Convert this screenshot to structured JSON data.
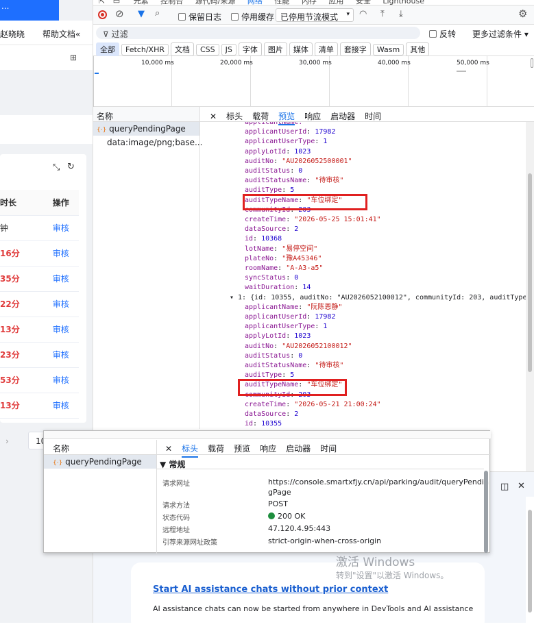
{
  "left": {
    "topbar_text": "...",
    "user_name": "赵晓晓",
    "help_doc": "帮助文档",
    "help_chevron": "«",
    "table": {
      "headers": [
        "时长",
        "操作"
      ],
      "rows": [
        {
          "duration": "钟",
          "action": "审核"
        },
        {
          "duration": "16分",
          "action": "审核"
        },
        {
          "duration": "35分",
          "action": "审核"
        },
        {
          "duration": "22分",
          "action": "审核"
        },
        {
          "duration": "13分",
          "action": "审核"
        },
        {
          "duration": "23分",
          "action": "审核"
        },
        {
          "duration": "53分",
          "action": "审核"
        },
        {
          "duration": "13分",
          "action": "审核"
        }
      ]
    },
    "pager_page": "10"
  },
  "devtools": {
    "top_tabs": [
      "元素",
      "控制台",
      "源代码/来源",
      "网络",
      "性能",
      "内存",
      "应用",
      "安全",
      "Lighthouse"
    ],
    "toolbar": {
      "preserve_log": "保留日志",
      "disable_cache": "停用缓存",
      "throttle": "已停用节流模式"
    },
    "filter": {
      "placeholder": "过滤",
      "invert": "反转",
      "more_filters": "更多过滤条件"
    },
    "filter_types": [
      "全部",
      "Fetch/XHR",
      "文档",
      "CSS",
      "JS",
      "字体",
      "图片",
      "媒体",
      "清单",
      "套接字",
      "Wasm",
      "其他"
    ],
    "timeline_ticks": [
      "10,000 ms",
      "20,000 ms",
      "30,000 ms",
      "40,000 ms",
      "50,000 ms"
    ],
    "list_header": "名称",
    "requests": [
      "queryPendingPage",
      "data:image/png;base..."
    ],
    "detail_tabs": [
      "标头",
      "载荷",
      "预览",
      "响应",
      "启动器",
      "时间"
    ],
    "preview": {
      "top_cut": "applicantName: \"\"",
      "item0": [
        {
          "k": "applicantUserId",
          "v": "17982",
          "t": "n"
        },
        {
          "k": "applicantUserType",
          "v": "1",
          "t": "n"
        },
        {
          "k": "applyLotId",
          "v": "1023",
          "t": "n"
        },
        {
          "k": "auditNo",
          "v": "\"AU2026052500001\"",
          "t": "s"
        },
        {
          "k": "auditStatus",
          "v": "0",
          "t": "n"
        },
        {
          "k": "auditStatusName",
          "v": "\"待审核\"",
          "t": "s"
        },
        {
          "k": "auditType",
          "v": "5",
          "t": "n"
        },
        {
          "k": "auditTypeName",
          "v": "\"车位绑定\"",
          "t": "s"
        },
        {
          "k": "communityId",
          "v": "203",
          "t": "n"
        },
        {
          "k": "createTime",
          "v": "\"2026-05-25 15:01:41\"",
          "t": "s"
        },
        {
          "k": "dataSource",
          "v": "2",
          "t": "n"
        },
        {
          "k": "id",
          "v": "10368",
          "t": "n"
        },
        {
          "k": "lotName",
          "v": "\"易停空间\"",
          "t": "s"
        },
        {
          "k": "plateNo",
          "v": "\"豫A45346\"",
          "t": "s"
        },
        {
          "k": "roomName",
          "v": "\"A-A3-a5\"",
          "t": "s"
        },
        {
          "k": "syncStatus",
          "v": "0",
          "t": "n"
        },
        {
          "k": "waitDuration",
          "v": "14",
          "t": "n"
        }
      ],
      "item1_header": "▾ 1: {id: 10355, auditNo: \"AU2026052100012\", communityId: 203, auditType: 5, auc",
      "item1": [
        {
          "k": "applicantName",
          "v": "\"阮陈恩静\"",
          "t": "s"
        },
        {
          "k": "applicantUserId",
          "v": "17982",
          "t": "n"
        },
        {
          "k": "applicantUserType",
          "v": "1",
          "t": "n"
        },
        {
          "k": "applyLotId",
          "v": "1023",
          "t": "n"
        },
        {
          "k": "auditNo",
          "v": "\"AU2026052100012\"",
          "t": "s"
        },
        {
          "k": "auditStatus",
          "v": "0",
          "t": "n"
        },
        {
          "k": "auditStatusName",
          "v": "\"待审核\"",
          "t": "s"
        },
        {
          "k": "auditType",
          "v": "5",
          "t": "n"
        },
        {
          "k": "auditTypeName",
          "v": "\"车位绑定\"",
          "t": "s"
        },
        {
          "k": "communityId",
          "v": "203",
          "t": "n"
        },
        {
          "k": "createTime",
          "v": "\"2026-05-21 21:00:24\"",
          "t": "s"
        },
        {
          "k": "dataSource",
          "v": "2",
          "t": "n"
        },
        {
          "k": "id",
          "v": "10355",
          "t": "n"
        }
      ]
    },
    "overlay": {
      "list_header": "名称",
      "request": "queryPendingPage",
      "tabs": [
        "标头",
        "载荷",
        "预览",
        "响应",
        "启动器",
        "时间"
      ],
      "section": "▼ 常规",
      "rows": [
        {
          "label": "请求网址",
          "value": "https://console.smartxfjy.cn/api/parking/audit/queryPendin",
          "value2": "gPage"
        },
        {
          "label": "请求方法",
          "value": "POST",
          "value2": ""
        },
        {
          "label": "状态代码",
          "value": "200 OK",
          "value2": ""
        },
        {
          "label": "远程地址",
          "value": "47.120.4.95:443",
          "value2": ""
        },
        {
          "label": "引荐来源网址政策",
          "value": "strict-origin-when-cross-origin",
          "value2": ""
        }
      ]
    },
    "watermark": {
      "line1": "激活 Windows",
      "line2": "转到\"设置\"以激活 Windows。"
    },
    "ai_card": {
      "title": "Start AI assistance chats without prior context",
      "body": "AI assistance chats can now be started from anywhere in DevTools and AI assistance"
    },
    "colors": {
      "accent": "#1a73e8",
      "highlight": "#e02020",
      "link": "#1a5fd0"
    }
  }
}
